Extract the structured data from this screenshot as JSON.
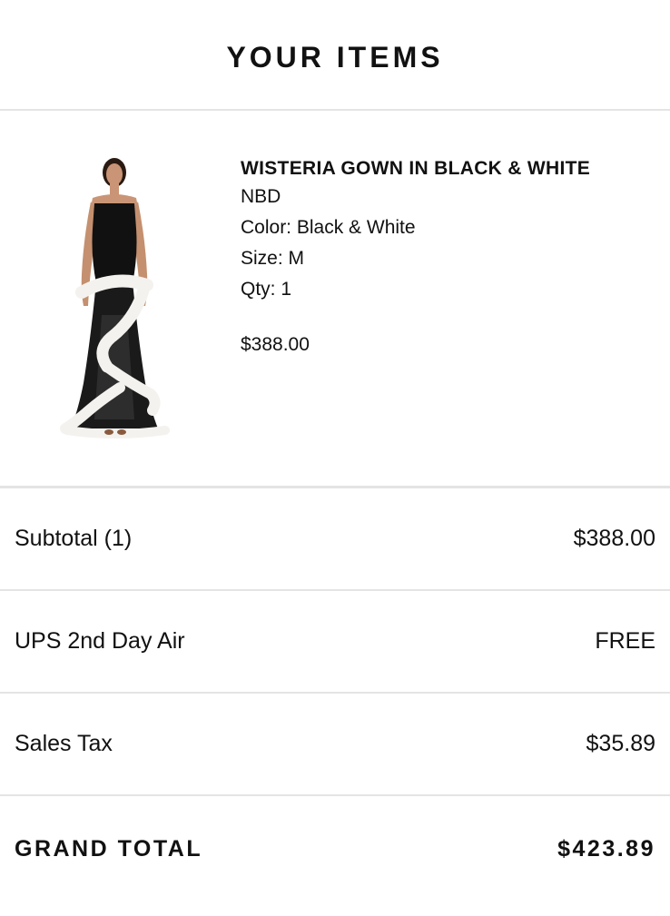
{
  "header": {
    "title": "YOUR ITEMS"
  },
  "item": {
    "image_alt": "Wisteria gown product photo",
    "name": "WISTERIA GOWN IN BLACK & WHITE",
    "brand": "NBD",
    "color": "Color: Black & White",
    "size": "Size: M",
    "qty": "Qty: 1",
    "price": "$388.00"
  },
  "summary": {
    "subtotal_label": "Subtotal (1)",
    "subtotal_value": "$388.00",
    "shipping_label": "UPS 2nd Day Air",
    "shipping_value": "FREE",
    "tax_label": "Sales Tax",
    "tax_value": "$35.89",
    "total_label": "GRAND TOTAL",
    "total_value": "$423.89"
  }
}
